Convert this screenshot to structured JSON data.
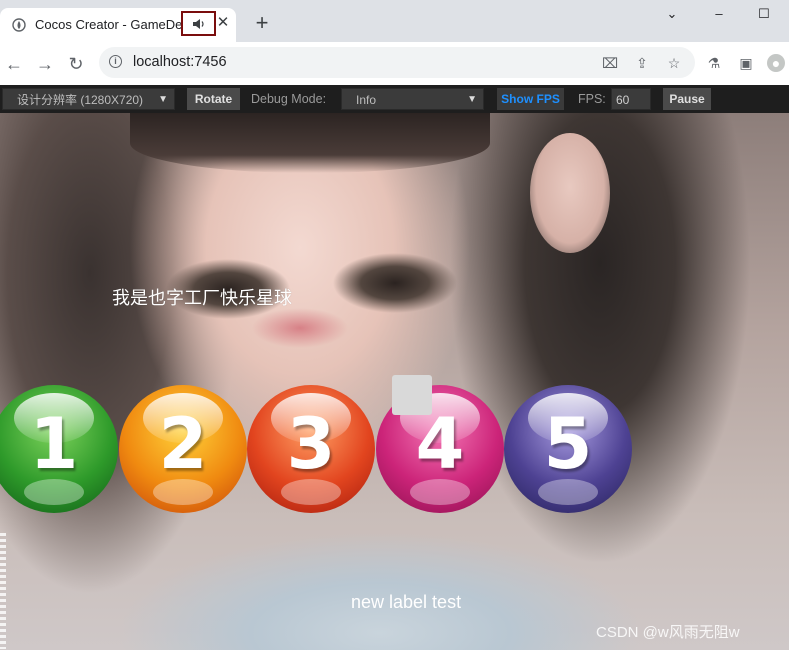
{
  "browser": {
    "tab_title": "Cocos Creator - GameDe",
    "tab_close": "✕",
    "new_tab": "+",
    "window_minimize": "⌄",
    "window_restore": "–",
    "window_max": "☐",
    "url": "localhost:7456",
    "icons": [
      "back-icon",
      "forward-icon",
      "reload-icon",
      "info-icon",
      "translate-icon",
      "share-icon",
      "star-icon",
      "extensions-icon",
      "sidepanel-icon",
      "profile-icon"
    ]
  },
  "cocos_toolbar": {
    "resolution_select": "设计分辨率 (1280X720)",
    "rotate_button": "Rotate",
    "debug_mode_label": "Debug Mode:",
    "debug_mode_select": "Info",
    "show_fps_button": "Show FPS",
    "fps_label": "FPS:",
    "fps_value": "60",
    "pause_button": "Pause",
    "show_fps_color": "#1e90ff"
  },
  "game": {
    "headline": "我是也字工厂快乐星球",
    "balls": [
      {
        "number": "1",
        "color": "#2e9a2a"
      },
      {
        "number": "2",
        "color": "#f08a10"
      },
      {
        "number": "3",
        "color": "#e2451f"
      },
      {
        "number": "4",
        "color": "#cc2479"
      },
      {
        "number": "5",
        "color": "#4e4293"
      }
    ],
    "bottom_label": "new label test",
    "watermark": "CSDN @w风雨无阻w"
  }
}
